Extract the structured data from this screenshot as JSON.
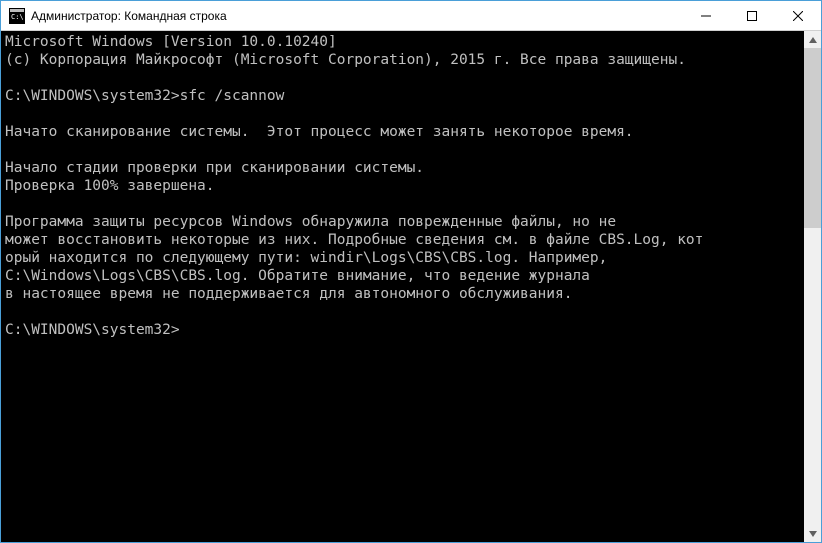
{
  "window": {
    "title": "Администратор: Командная строка"
  },
  "console": {
    "line1": "Microsoft Windows [Version 10.0.10240]",
    "line2": "(c) Корпорация Майкрософт (Microsoft Corporation), 2015 г. Все права защищены.",
    "blank1": "",
    "prompt1": "C:\\WINDOWS\\system32>sfc /scannow",
    "blank2": "",
    "line3": "Начато сканирование системы.  Этот процесс может занять некоторое время.",
    "blank3": "",
    "line4": "Начало стадии проверки при сканировании системы.",
    "line5": "Проверка 100% завершена.",
    "blank4": "",
    "line6": "Программа защиты ресурсов Windows обнаружила поврежденные файлы, но не",
    "line7": "может восстановить некоторые из них. Подробные сведения см. в файле CBS.Log, кот",
    "line8": "орый находится по следующему пути: windir\\Logs\\CBS\\CBS.log. Например,",
    "line9": "C:\\Windows\\Logs\\CBS\\CBS.log. Обратите внимание, что ведение журнала",
    "line10": "в настоящее время не поддерживается для автономного обслуживания.",
    "blank5": "",
    "prompt2": "C:\\WINDOWS\\system32>"
  }
}
